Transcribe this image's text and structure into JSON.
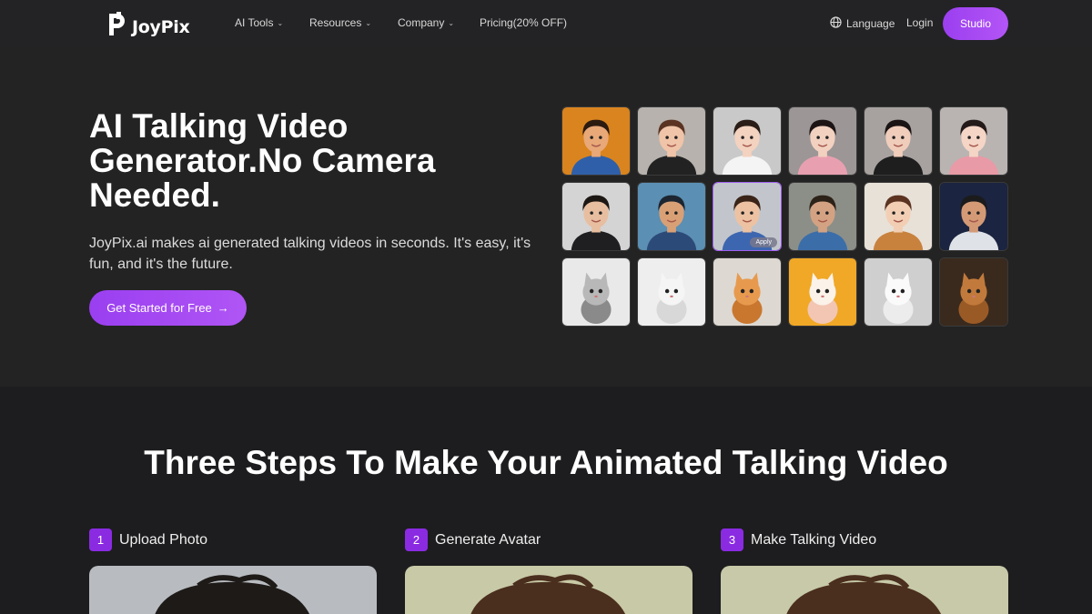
{
  "nav": {
    "logo_text": "JoyPix",
    "items": [
      {
        "label": "AI Tools",
        "has_dropdown": true
      },
      {
        "label": "Resources",
        "has_dropdown": true
      },
      {
        "label": "Company",
        "has_dropdown": true
      },
      {
        "label": "Pricing(20% OFF)",
        "has_dropdown": false
      }
    ],
    "language_label": "Language",
    "login_label": "Login",
    "studio_label": "Studio"
  },
  "hero": {
    "title": "AI Talking Video Generator.No Camera Needed.",
    "description": "JoyPix.ai makes ai generated talking videos in seconds. It's easy, it's fun, and it's the future.",
    "cta_label": "Get Started for Free",
    "cta_arrow": "→",
    "apply_label": "Apply"
  },
  "avatar_grid": [
    {
      "kind": "cartoon-boy-avatar",
      "bg": "#d9841f",
      "skin": "#e8a878",
      "hair": "#2b1a10",
      "shirt": "#2f5fa8"
    },
    {
      "kind": "cartoon-girl-avatar",
      "bg": "#b7b2ad",
      "skin": "#f0c4a8",
      "hair": "#5a3322",
      "shirt": "#222222"
    },
    {
      "kind": "cartoon-woman-avatar",
      "bg": "#c9c9c9",
      "skin": "#f3d2bf",
      "hair": "#2a1d17",
      "shirt": "#f4f4f4"
    },
    {
      "kind": "anime-woman-avatar",
      "bg": "#9c9696",
      "skin": "#f2d1c0",
      "hair": "#1d1515",
      "shirt": "#e8a0b0"
    },
    {
      "kind": "anime-woman-avatar-2",
      "bg": "#a7a2a0",
      "skin": "#f0cdbb",
      "hair": "#1a1414",
      "shirt": "#1e1e1e"
    },
    {
      "kind": "anime-girl-avatar",
      "bg": "#b9b4b2",
      "skin": "#f5d5c6",
      "hair": "#241a1a",
      "shirt": "#e89aa6"
    },
    {
      "kind": "man-suit-avatar",
      "bg": "#d4d4d4",
      "skin": "#e8bea0",
      "hair": "#1d1714",
      "shirt": "#1f1f22"
    },
    {
      "kind": "cartoon-man-avatar",
      "bg": "#5b8fb3",
      "skin": "#d9a076",
      "hair": "#1c2530",
      "shirt": "#2c4a78"
    },
    {
      "kind": "cartoon-boy-avatar-selected",
      "bg": "#c2c6cc",
      "skin": "#edc2a2",
      "hair": "#3a2418",
      "shirt": "#3d66b0"
    },
    {
      "kind": "bearded-man-avatar",
      "bg": "#8c8f88",
      "skin": "#d3a283",
      "hair": "#2d2218",
      "shirt": "#3b6ea8"
    },
    {
      "kind": "anime-boy-avatar",
      "bg": "#e8e1d8",
      "skin": "#f2cfb4",
      "hair": "#5b3320",
      "shirt": "#c8823e"
    },
    {
      "kind": "astronaut-avatar",
      "bg": "#1b2440",
      "skin": "#d49a76",
      "hair": "#1b1b1b",
      "shirt": "#dfe3e8"
    },
    {
      "kind": "kitten-avatar",
      "bg": "#e9e9e9",
      "skin": "#b8b8b8",
      "hair": "#8a8a8a",
      "shirt": "#e9e9e9"
    },
    {
      "kind": "white-cat-avatar",
      "bg": "#eeeeee",
      "skin": "#f5f5f5",
      "hair": "#d8d8d8",
      "shirt": "#eeeeee"
    },
    {
      "kind": "orange-kitten-avatar",
      "bg": "#ddd8d2",
      "skin": "#e79a4e",
      "hair": "#c9772f",
      "shirt": "#ddd8d2"
    },
    {
      "kind": "bunny-avatar",
      "bg": "#f0a826",
      "skin": "#fbf2e9",
      "hair": "#f2c6b3",
      "shirt": "#f0a826"
    },
    {
      "kind": "white-fluffy-avatar",
      "bg": "#cfcfcf",
      "skin": "#fafafa",
      "hair": "#ececec",
      "shirt": "#cfcfcf"
    },
    {
      "kind": "brown-cat-avatar",
      "bg": "#3a2a1e",
      "skin": "#c27a3c",
      "hair": "#9a5a26",
      "shirt": "#3a2a1e"
    }
  ],
  "steps_section": {
    "title": "Three Steps To Make Your Animated Talking Video",
    "steps": [
      {
        "number": "1",
        "label": "Upload Photo",
        "bg": "#b8bcc0",
        "hair": "#1e1a18"
      },
      {
        "number": "2",
        "label": "Generate Avatar",
        "bg": "#c8c9a6",
        "hair": "#4a2e1e"
      },
      {
        "number": "3",
        "label": "Make Talking Video",
        "bg": "#c7c9a8",
        "hair": "#4a2e1e"
      }
    ]
  },
  "colors": {
    "accent": "#9b3ff0",
    "step_badge": "#8a2be2",
    "page_bg": "#1d1d1f"
  }
}
